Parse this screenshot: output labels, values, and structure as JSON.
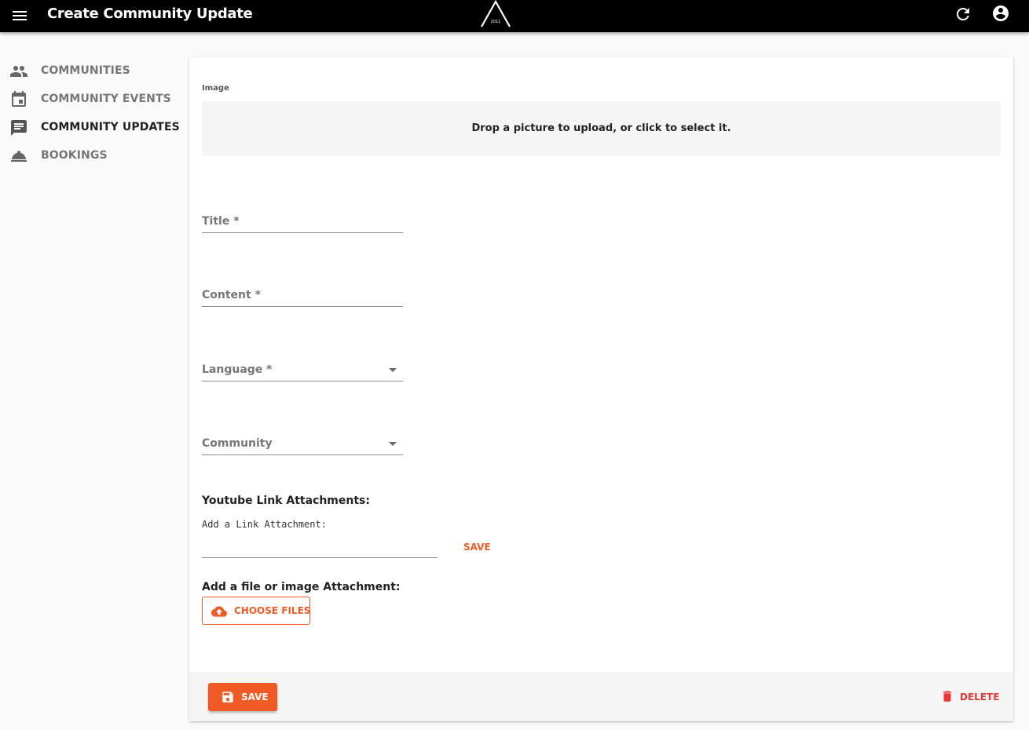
{
  "appbar": {
    "title": "Create Community Update",
    "logo_text": "2011",
    "icons": [
      "menu-icon",
      "refresh-icon",
      "account-circle-icon"
    ]
  },
  "sidebar": {
    "items": [
      {
        "label": "COMMUNITIES",
        "icon": "people-icon",
        "active": false
      },
      {
        "label": "COMMUNITY EVENTS",
        "icon": "calendar-icon",
        "active": false
      },
      {
        "label": "COMMUNITY UPDATES",
        "icon": "message-icon",
        "active": true
      },
      {
        "label": "BOOKINGS",
        "icon": "room-service-icon",
        "active": false
      }
    ]
  },
  "form": {
    "image_label": "Image",
    "dropzone_text": "Drop a picture to upload, or click to select it.",
    "title_label": "Title *",
    "content_label": "Content *",
    "language_label": "Language *",
    "community_label": "Community",
    "youtube_heading": "Youtube Link Attachments:",
    "link_hint": "Add a Link Attachment:",
    "link_value": "",
    "link_save_label": "SAVE",
    "file_heading": "Add a file or image Attachment:",
    "choose_files_label": "CHOOSE FILES"
  },
  "footer": {
    "save_label": "SAVE",
    "delete_label": "DELETE"
  },
  "colors": {
    "accent": "#f05a24",
    "danger": "#e53935",
    "appbar": "#000000"
  }
}
